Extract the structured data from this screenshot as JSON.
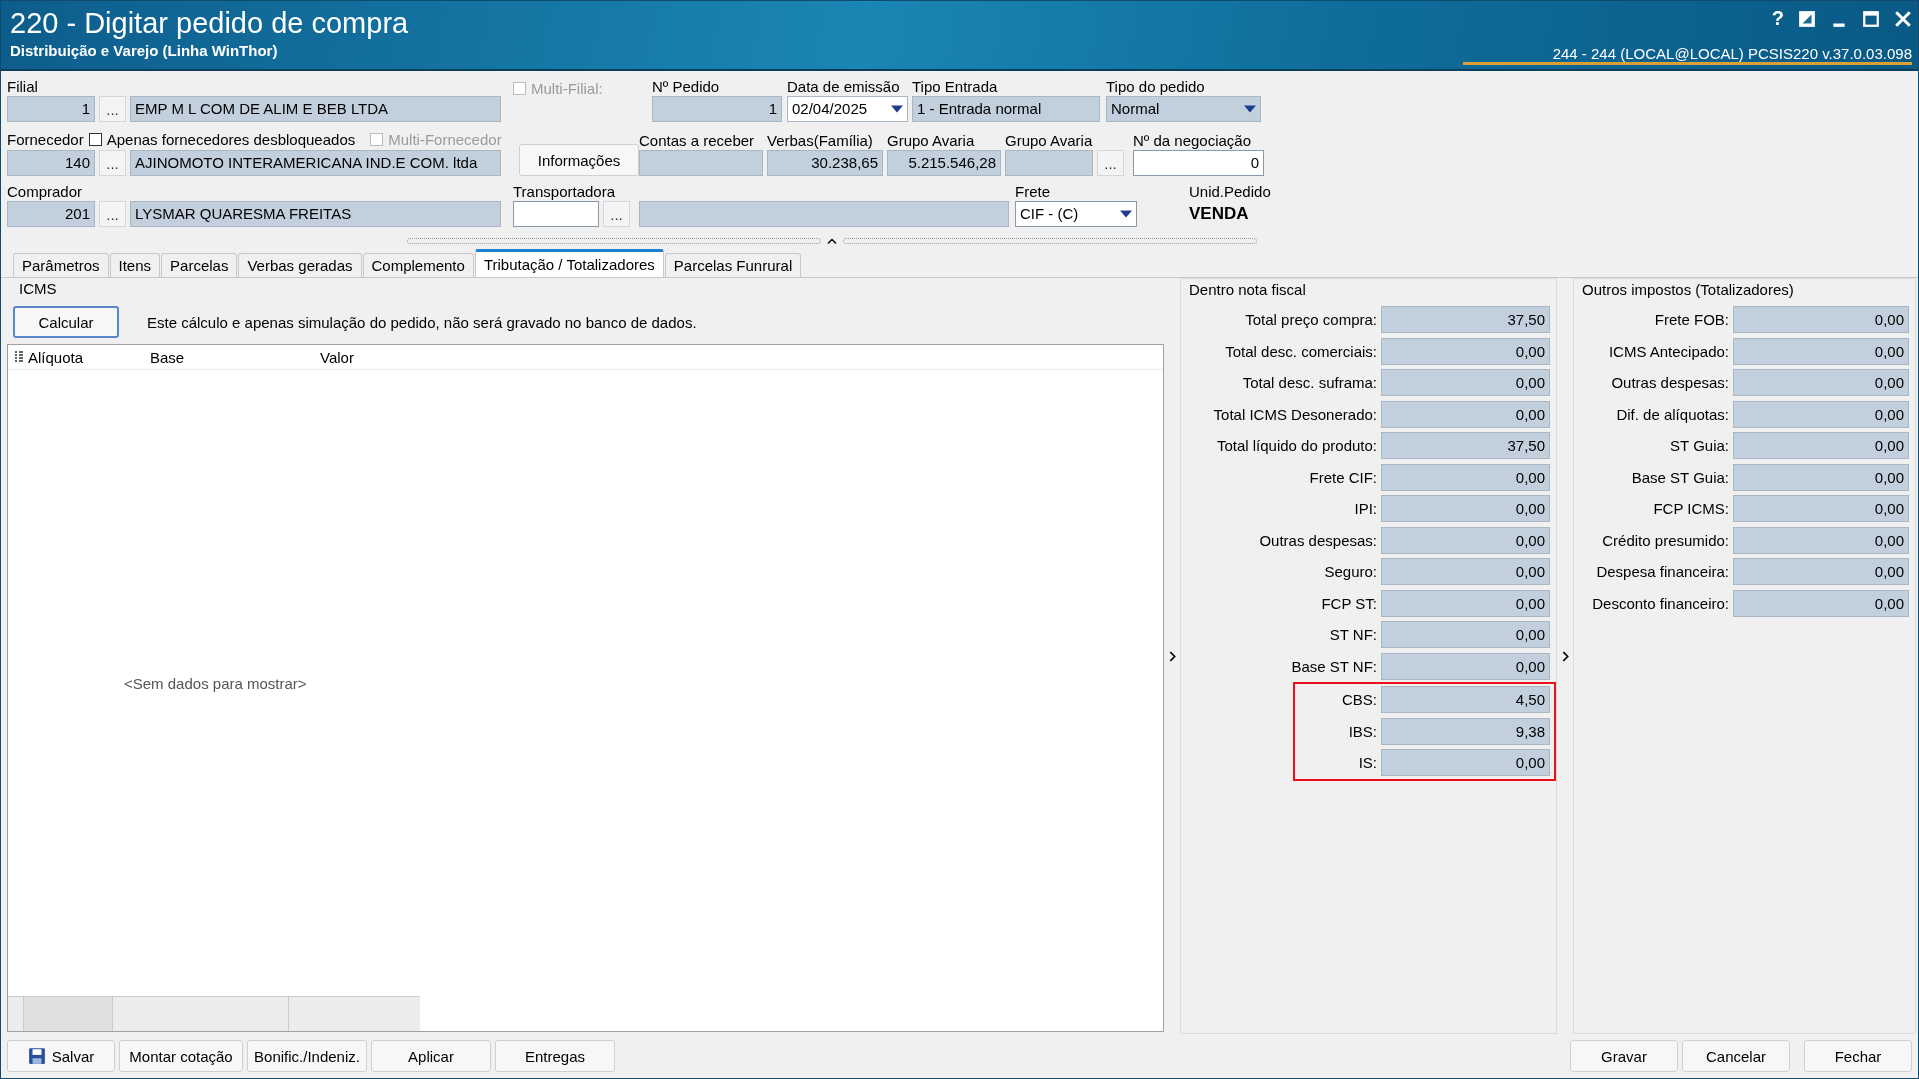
{
  "window": {
    "title": "220 - Digitar pedido de compra",
    "subtitle": "Distribuição e Varejo (Linha WinThor)",
    "session": "244 - 244 (LOCAL@LOCAL)   PCSIS220  v.37.0.03.098",
    "help": "?"
  },
  "form": {
    "filial": {
      "label": "Filial",
      "code": "1",
      "dots": "...",
      "name": "EMP M L COM DE ALIM E BEB LTDA"
    },
    "multi_filial": {
      "label": "Multi-Filial:",
      "checked": false,
      "disabled": true
    },
    "pedido": {
      "label": "Nº Pedido",
      "value": "1"
    },
    "emissao": {
      "label": "Data de emissão",
      "value": "02/04/2025"
    },
    "tipo_entrada": {
      "label": "Tipo Entrada",
      "value": "1 - Entrada normal"
    },
    "tipo_pedido": {
      "label": "Tipo do pedido",
      "value": "Normal"
    },
    "fornecedor": {
      "label": "Fornecedor",
      "code": "140",
      "dots": "...",
      "name": "AJINOMOTO INTERAMERICANA IND.E COM. ltda"
    },
    "apenas_desbloqueados": {
      "label": "Apenas fornecedores desbloqueados",
      "checked": false,
      "disabled": false
    },
    "multi_fornecedor": {
      "label": "Multi-Fornecedor",
      "checked": false,
      "disabled": true
    },
    "informacoes_button": "Informações",
    "contas_receber": {
      "label": "Contas a receber"
    },
    "verbas": {
      "label": "Verbas(Família)",
      "value": "30.238,65"
    },
    "grupo_avaria_1": {
      "label": "Grupo Avaria",
      "value": "5.215.546,28"
    },
    "grupo_avaria_2": {
      "label": "Grupo Avaria",
      "dots": "..."
    },
    "negociacao": {
      "label": "Nº da negociação",
      "value": "0"
    },
    "comprador": {
      "label": "Comprador",
      "code": "201",
      "dots": "...",
      "name": "LYSMAR QUARESMA FREITAS"
    },
    "transportadora": {
      "label": "Transportadora",
      "dots": "..."
    },
    "frete": {
      "label": "Frete",
      "value": "CIF - (C)"
    },
    "unid_pedido": {
      "label": "Unid.Pedido",
      "value": "VENDA"
    }
  },
  "tabs": [
    {
      "label": "Parâmetros",
      "selected": false
    },
    {
      "label": "Itens",
      "selected": false
    },
    {
      "label": "Parcelas",
      "selected": false
    },
    {
      "label": "Verbas geradas",
      "selected": false
    },
    {
      "label": "Complemento",
      "selected": false
    },
    {
      "label": "Tributação / Totalizadores",
      "selected": true
    },
    {
      "label": "Parcelas Funrural",
      "selected": false
    }
  ],
  "icms": {
    "legend": "ICMS",
    "button": "Calcular",
    "note": "Este cálculo e apenas  simulação do pedido, não será gravado no banco de dados.",
    "columns": [
      "Alíquota",
      "Base",
      "Valor"
    ],
    "empty": "<Sem dados para mostrar>"
  },
  "panels": [
    {
      "title": "Dentro nota fiscal",
      "rows": [
        {
          "label": "Total preço compra:",
          "value": "37,50",
          "highlighted": false
        },
        {
          "label": "Total desc. comerciais:",
          "value": "0,00",
          "highlighted": false
        },
        {
          "label": "Total desc. suframa:",
          "value": "0,00",
          "highlighted": false
        },
        {
          "label": "Total ICMS Desonerado:",
          "value": "0,00",
          "highlighted": false
        },
        {
          "label": "Total líquido do produto:",
          "value": "37,50",
          "highlighted": false
        },
        {
          "label": "Frete CIF:",
          "value": "0,00",
          "highlighted": false
        },
        {
          "label": "IPI:",
          "value": "0,00",
          "highlighted": false
        },
        {
          "label": "Outras despesas:",
          "value": "0,00",
          "highlighted": false
        },
        {
          "label": "Seguro:",
          "value": "0,00",
          "highlighted": false
        },
        {
          "label": "FCP ST:",
          "value": "0,00",
          "highlighted": false
        },
        {
          "label": "ST NF:",
          "value": "0,00",
          "highlighted": false
        },
        {
          "label": "Base ST NF:",
          "value": "0,00",
          "highlighted": false
        },
        {
          "label": "CBS:",
          "value": "4,50",
          "highlighted": true
        },
        {
          "label": "IBS:",
          "value": "9,38",
          "highlighted": true
        },
        {
          "label": "IS:",
          "value": "0,00",
          "highlighted": true
        }
      ]
    },
    {
      "title": "Outros impostos (Totalizadores)",
      "rows": [
        {
          "label": "Frete FOB:",
          "value": "0,00",
          "highlighted": false
        },
        {
          "label": "ICMS Antecipado:",
          "value": "0,00",
          "highlighted": false
        },
        {
          "label": "Outras despesas:",
          "value": "0,00",
          "highlighted": false
        },
        {
          "label": "Dif. de alíquotas:",
          "value": "0,00",
          "highlighted": false
        },
        {
          "label": "ST Guia:",
          "value": "0,00",
          "highlighted": false
        },
        {
          "label": "Base ST Guia:",
          "value": "0,00",
          "highlighted": false
        },
        {
          "label": "FCP ICMS:",
          "value": "0,00",
          "highlighted": false
        },
        {
          "label": "Crédito presumido:",
          "value": "0,00",
          "highlighted": false
        },
        {
          "label": "Despesa financeira:",
          "value": "0,00",
          "highlighted": false
        },
        {
          "label": "Desconto financeiro:",
          "value": "0,00",
          "highlighted": false
        }
      ]
    }
  ],
  "buttons_left": [
    {
      "label": "Salvar",
      "kind": "save"
    },
    {
      "label": "Montar cotação",
      "kind": "plain"
    },
    {
      "label": "Bonific./Indeniz.",
      "kind": "plain"
    },
    {
      "label": "Aplicar",
      "kind": "plain"
    },
    {
      "label": "Entregas",
      "kind": "plain"
    }
  ],
  "buttons_right": [
    "Gravar",
    "Cancelar",
    "Fechar"
  ]
}
